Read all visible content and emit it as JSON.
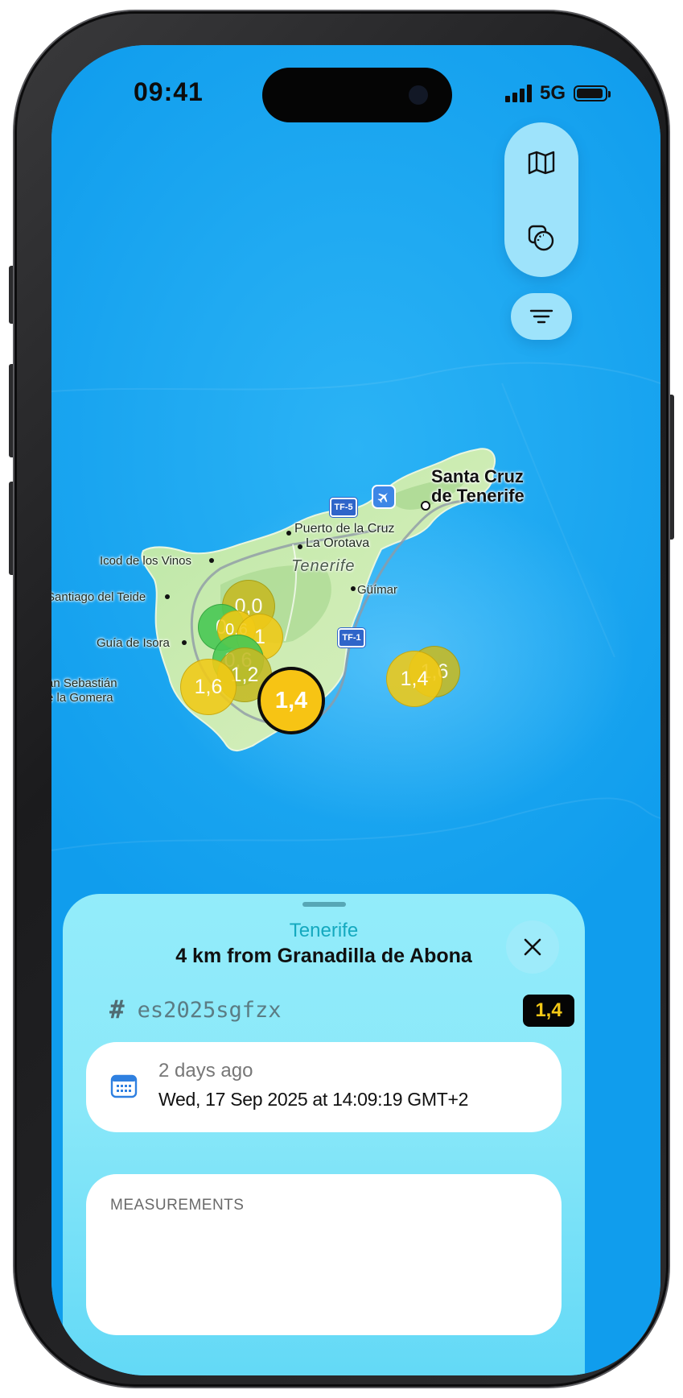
{
  "status_bar": {
    "time": "09:41",
    "network": "5G"
  },
  "map": {
    "labels": {
      "santa_cruz_line1": "Santa Cruz",
      "santa_cruz_line2": "de Tenerife",
      "puerto_cruz": "Puerto de la Cruz",
      "la_orotava": "La Orotava",
      "tenerife": "Tenerife",
      "icod": "Icod de los Vinos",
      "santiago_teide": "Santiago del Teide",
      "guimar": "Güímar",
      "guia_isora": "Guía de Isora",
      "san_sebastian_line1": "an Sebastián",
      "san_sebastian_line2": "e la Gomera"
    },
    "road_shields": [
      "TF-5",
      "TF-1"
    ],
    "quakes": [
      {
        "mag": "0,0",
        "color": "olive"
      },
      {
        "mag": "0",
        "color": "green"
      },
      {
        "mag": "0,6",
        "color": "yellow"
      },
      {
        "mag": "1",
        "color": "yellow"
      },
      {
        "mag": "0,6",
        "color": "green"
      },
      {
        "mag": "1,2",
        "color": "olive"
      },
      {
        "mag": "1,6",
        "color": "yellow"
      },
      {
        "mag": "1,4",
        "color": "yellow",
        "selected": true
      },
      {
        "mag": "1,6",
        "color": "olive"
      },
      {
        "mag": "1,4",
        "color": "yellow"
      }
    ]
  },
  "controls": {
    "map_icon": "map-icon",
    "layers_icon": "layers-icon",
    "filter_icon": "filter-icon"
  },
  "sheet": {
    "region": "Tenerife",
    "title": "4 km from Granadilla de Abona",
    "event_id": "es2025sgfzx",
    "magnitude": "1,4",
    "magnitude_color": "#f3c817",
    "time_relative": "2 days ago",
    "time_absolute": "Wed, 17 Sep 2025 at 14:09:19 GMT+2",
    "measurements_title": "MEASUREMENTS"
  }
}
